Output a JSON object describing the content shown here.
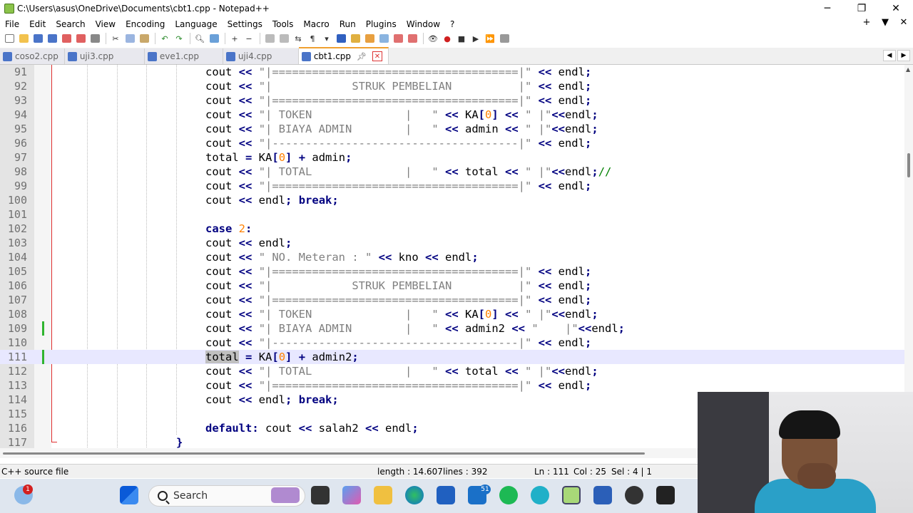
{
  "window": {
    "title": "C:\\Users\\asus\\OneDrive\\Documents\\cbt1.cpp - Notepad++",
    "minimize": "─",
    "maximize": "❐",
    "close": "✕"
  },
  "menu": {
    "items": [
      "File",
      "Edit",
      "Search",
      "View",
      "Encoding",
      "Language",
      "Settings",
      "Tools",
      "Macro",
      "Run",
      "Plugins",
      "Window",
      "?"
    ],
    "right": [
      "+",
      "▼",
      "✕"
    ]
  },
  "tabs": [
    {
      "label": "coso2.cpp",
      "active": false
    },
    {
      "label": "uji3.cpp",
      "active": false
    },
    {
      "label": "eve1.cpp",
      "active": false
    },
    {
      "label": "uji4.cpp",
      "active": false
    },
    {
      "label": "cbt1.cpp",
      "active": true
    }
  ],
  "editor": {
    "current_line": 111,
    "lines": [
      {
        "n": "91",
        "html": "<span class=\"cmt\"></span>cout <span class=\"op\">&lt;&lt;</span> <span class=\"str\">\"|=====================================|\"</span> <span class=\"op\">&lt;&lt;</span> endl<span class=\"op\">;</span>"
      },
      {
        "n": "92",
        "html": "cout <span class=\"op\">&lt;&lt;</span> <span class=\"str\">\"|            STRUK PEMBELIAN          |\"</span> <span class=\"op\">&lt;&lt;</span> endl<span class=\"op\">;</span>"
      },
      {
        "n": "93",
        "html": "cout <span class=\"op\">&lt;&lt;</span> <span class=\"str\">\"|=====================================|\"</span> <span class=\"op\">&lt;&lt;</span> endl<span class=\"op\">;</span>"
      },
      {
        "n": "94",
        "html": "cout <span class=\"op\">&lt;&lt;</span> <span class=\"str\">\"| TOKEN              |   \"</span> <span class=\"op\">&lt;&lt;</span> KA<span class=\"op\">[</span><span class=\"num\">0</span><span class=\"op\">]</span> <span class=\"op\">&lt;&lt;</span> <span class=\"str\">\" |\"</span><span class=\"op\">&lt;&lt;</span>endl<span class=\"op\">;</span>"
      },
      {
        "n": "95",
        "html": "cout <span class=\"op\">&lt;&lt;</span> <span class=\"str\">\"| BIAYA ADMIN        |   \"</span> <span class=\"op\">&lt;&lt;</span> admin <span class=\"op\">&lt;&lt;</span> <span class=\"str\">\" |\"</span><span class=\"op\">&lt;&lt;</span>endl<span class=\"op\">;</span>"
      },
      {
        "n": "96",
        "html": "cout <span class=\"op\">&lt;&lt;</span> <span class=\"str\">\"|-------------------------------------|\"</span> <span class=\"op\">&lt;&lt;</span> endl<span class=\"op\">;</span>"
      },
      {
        "n": "97",
        "html": "total <span class=\"op\">=</span> KA<span class=\"op\">[</span><span class=\"num\">0</span><span class=\"op\">]</span> <span class=\"op\">+</span> admin<span class=\"op\">;</span>"
      },
      {
        "n": "98",
        "html": "cout <span class=\"op\">&lt;&lt;</span> <span class=\"str\">\"| TOTAL              |   \"</span> <span class=\"op\">&lt;&lt;</span> total <span class=\"op\">&lt;&lt;</span> <span class=\"str\">\" |\"</span><span class=\"op\">&lt;&lt;</span>endl<span class=\"op\">;</span><span class=\"cmt\">//</span>"
      },
      {
        "n": "99",
        "html": "cout <span class=\"op\">&lt;&lt;</span> <span class=\"str\">\"|=====================================|\"</span> <span class=\"op\">&lt;&lt;</span> endl<span class=\"op\">;</span>"
      },
      {
        "n": "100",
        "html": "cout <span class=\"op\">&lt;&lt;</span> endl<span class=\"op\">;</span> <span class=\"kw\">break</span><span class=\"op\">;</span>"
      },
      {
        "n": "101",
        "html": ""
      },
      {
        "n": "102",
        "html": "<span class=\"kw\">case</span> <span class=\"num\">2</span><span class=\"op\">:</span>"
      },
      {
        "n": "103",
        "html": "cout <span class=\"op\">&lt;&lt;</span> endl<span class=\"op\">;</span>"
      },
      {
        "n": "104",
        "html": "cout <span class=\"op\">&lt;&lt;</span> <span class=\"str\">\" NO. Meteran : \"</span> <span class=\"op\">&lt;&lt;</span> kno <span class=\"op\">&lt;&lt;</span> endl<span class=\"op\">;</span>"
      },
      {
        "n": "105",
        "html": "cout <span class=\"op\">&lt;&lt;</span> <span class=\"str\">\"|=====================================|\"</span> <span class=\"op\">&lt;&lt;</span> endl<span class=\"op\">;</span>"
      },
      {
        "n": "106",
        "html": "cout <span class=\"op\">&lt;&lt;</span> <span class=\"str\">\"|            STRUK PEMBELIAN          |\"</span> <span class=\"op\">&lt;&lt;</span> endl<span class=\"op\">;</span>"
      },
      {
        "n": "107",
        "html": "cout <span class=\"op\">&lt;&lt;</span> <span class=\"str\">\"|=====================================|\"</span> <span class=\"op\">&lt;&lt;</span> endl<span class=\"op\">;</span>"
      },
      {
        "n": "108",
        "html": "cout <span class=\"op\">&lt;&lt;</span> <span class=\"str\">\"| TOKEN              |   \"</span> <span class=\"op\">&lt;&lt;</span> KA<span class=\"op\">[</span><span class=\"num\">0</span><span class=\"op\">]</span> <span class=\"op\">&lt;&lt;</span> <span class=\"str\">\" |\"</span><span class=\"op\">&lt;&lt;</span>endl<span class=\"op\">;</span>"
      },
      {
        "n": "109",
        "html": "cout <span class=\"op\">&lt;&lt;</span> <span class=\"str\">\"| BIAYA ADMIN        |   \"</span> <span class=\"op\">&lt;&lt;</span> admin2 <span class=\"op\">&lt;&lt;</span> <span class=\"str\">\"    |\"</span><span class=\"op\">&lt;&lt;</span>endl<span class=\"op\">;</span>",
        "changed": true
      },
      {
        "n": "110",
        "html": "cout <span class=\"op\">&lt;&lt;</span> <span class=\"str\">\"|-------------------------------------|\"</span> <span class=\"op\">&lt;&lt;</span> endl<span class=\"op\">;</span>"
      },
      {
        "n": "111",
        "html": "<span class=\"hl\">total</span> <span class=\"op\">=</span> KA<span class=\"op\">[</span><span class=\"num\">0</span><span class=\"op\">]</span> <span class=\"op\">+</span> admin2<span class=\"op\">;</span>",
        "changed": true
      },
      {
        "n": "112",
        "html": "cout <span class=\"op\">&lt;&lt;</span> <span class=\"str\">\"| TOTAL              |   \"</span> <span class=\"op\">&lt;&lt;</span> total <span class=\"op\">&lt;&lt;</span> <span class=\"str\">\" |\"</span><span class=\"op\">&lt;&lt;</span>endl<span class=\"op\">;</span>"
      },
      {
        "n": "113",
        "html": "cout <span class=\"op\">&lt;&lt;</span> <span class=\"str\">\"|=====================================|\"</span> <span class=\"op\">&lt;&lt;</span> endl<span class=\"op\">;</span>"
      },
      {
        "n": "114",
        "html": "cout <span class=\"op\">&lt;&lt;</span> endl<span class=\"op\">;</span> <span class=\"kw\">break</span><span class=\"op\">;</span>"
      },
      {
        "n": "115",
        "html": ""
      },
      {
        "n": "116",
        "html": "<span class=\"kw\">default</span><span class=\"op\">:</span> cout <span class=\"op\">&lt;&lt;</span> salah2 <span class=\"op\">&lt;&lt;</span> endl<span class=\"op\">;</span>"
      },
      {
        "n": "117",
        "html": "<span class=\"op\">}</span>",
        "indent": "outer"
      }
    ]
  },
  "status": {
    "filetype": "C++ source file",
    "length": "length : 14.607",
    "lines": "lines : 392",
    "ln": "Ln : 111",
    "col": "Col : 25",
    "sel": "Sel : 4 | 1"
  },
  "taskbar": {
    "search_label": "Search",
    "weather_badge": "1",
    "notif_badge": "51"
  },
  "colors": {
    "keyword": "#000080",
    "string": "#808080",
    "number": "#ff8000",
    "comment": "#008000",
    "current_line": "#e8e8ff"
  }
}
